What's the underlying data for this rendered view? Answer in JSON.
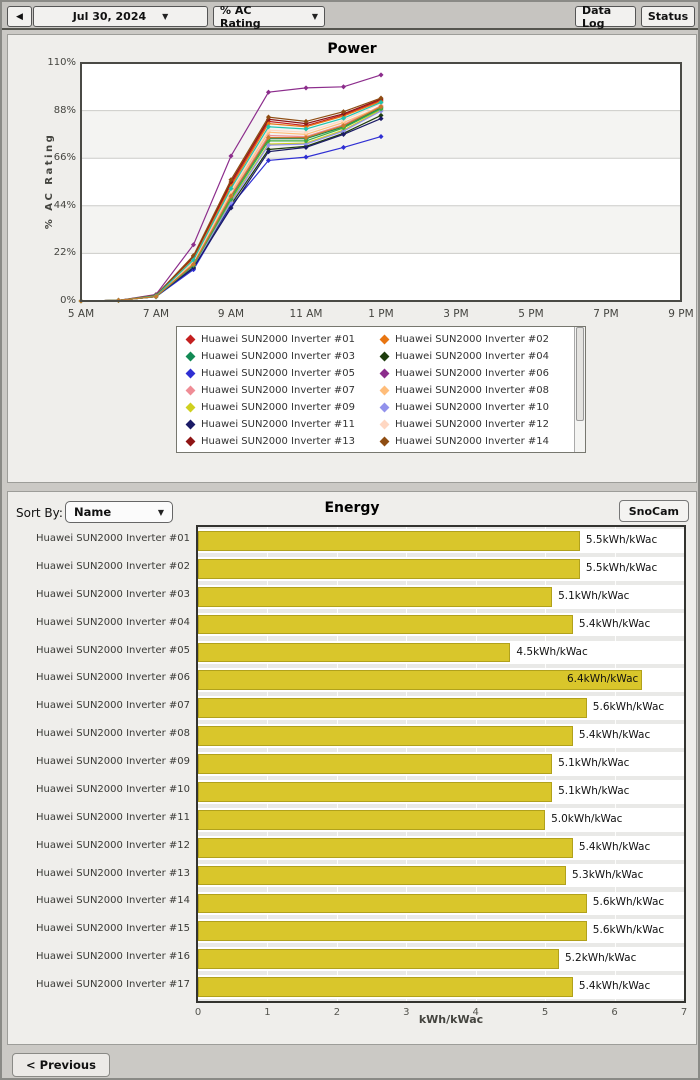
{
  "toolbar": {
    "prev_day_arrow": "◀",
    "date": "Jul 30, 2024",
    "metric": "% AC Rating",
    "dropdown_caret": "▼",
    "data_log": "Data Log",
    "status": "Status"
  },
  "energy_header": {
    "sort_by_label": "Sort By:",
    "sort_by_value": "Name",
    "select_caret": "▼",
    "snocam": "SnoCam"
  },
  "footer": {
    "previous": "< Previous"
  },
  "chart_data": [
    {
      "type": "line",
      "title": "Power",
      "ylabel": "% AC Rating",
      "xlim_hours": [
        5,
        21
      ],
      "ylim": [
        0,
        110
      ],
      "yticks": [
        "0%",
        "22%",
        "44%",
        "66%",
        "88%",
        "110%"
      ],
      "ytick_values": [
        0,
        22,
        44,
        66,
        88,
        110
      ],
      "xticks": [
        "5 AM",
        "7 AM",
        "9 AM",
        "11 AM",
        "1 PM",
        "3 PM",
        "5 PM",
        "7 PM",
        "9 PM"
      ],
      "xtick_hours": [
        5,
        7,
        9,
        11,
        13,
        15,
        17,
        19,
        21
      ],
      "x_hours": [
        5,
        6,
        7,
        8,
        9,
        10,
        11,
        12,
        13
      ],
      "grid": true,
      "legend_position": "bottom",
      "series": [
        {
          "name": "Huawei SUN2000 Inverter #01",
          "color": "#c42020",
          "in_legend": true,
          "values": [
            0,
            0.3,
            2.5,
            20,
            54,
            83,
            81,
            86,
            92.8
          ]
        },
        {
          "name": "Huawei SUN2000 Inverter #02",
          "color": "#e87511",
          "in_legend": true,
          "values": [
            0,
            0.3,
            2.5,
            19.5,
            53,
            82,
            80.5,
            85.5,
            92.3
          ]
        },
        {
          "name": "Huawei SUN2000 Inverter #03",
          "color": "#128a54",
          "in_legend": true,
          "values": [
            0,
            0.3,
            2.1,
            17,
            48,
            75,
            75,
            80.5,
            89.3
          ]
        },
        {
          "name": "Huawei SUN2000 Inverter #04",
          "color": "#1e3d0d",
          "in_legend": true,
          "values": [
            0,
            0.3,
            2,
            15,
            44.5,
            70,
            71.5,
            77.5,
            85.8
          ]
        },
        {
          "name": "Huawei SUN2000 Inverter #05",
          "color": "#2f2fd3",
          "in_legend": true,
          "values": [
            0,
            0.3,
            2,
            14.5,
            44,
            65,
            66.5,
            71,
            76
          ]
        },
        {
          "name": "Huawei SUN2000 Inverter #06",
          "color": "#8c2d8c",
          "in_legend": true,
          "values": [
            0,
            0.3,
            3,
            26,
            67,
            96.5,
            98.5,
            99,
            104.5
          ]
        },
        {
          "name": "Huawei SUN2000 Inverter #07",
          "color": "#ef8d96",
          "in_legend": true,
          "values": [
            0,
            0.3,
            2.2,
            17.5,
            49,
            76.5,
            76,
            81.5,
            90.3
          ]
        },
        {
          "name": "Huawei SUN2000 Inverter #08",
          "color": "#ffbd7a",
          "in_legend": true,
          "values": [
            0,
            0.3,
            2.2,
            18,
            50,
            78,
            77,
            82.5,
            89.8
          ]
        },
        {
          "name": "Huawei SUN2000 Inverter #09",
          "color": "#cfd01f",
          "in_legend": true,
          "values": [
            0,
            0.3,
            2,
            16,
            46,
            72.5,
            73,
            79,
            88.3
          ]
        },
        {
          "name": "Huawei SUN2000 Inverter #10",
          "color": "#9292ec",
          "in_legend": true,
          "values": [
            0,
            0.3,
            2,
            16,
            45.5,
            72,
            72.5,
            78.5,
            87.8
          ]
        },
        {
          "name": "Huawei SUN2000 Inverter #11",
          "color": "#1b1b66",
          "in_legend": true,
          "values": [
            0,
            0.3,
            2,
            15.5,
            43,
            69,
            71,
            77,
            84.3
          ]
        },
        {
          "name": "Huawei SUN2000 Inverter #12",
          "color": "#ffd7c2",
          "in_legend": true,
          "values": [
            0,
            0.3,
            2.3,
            18.5,
            51,
            79,
            78,
            83.5,
            91.3
          ]
        },
        {
          "name": "Huawei SUN2000 Inverter #13",
          "color": "#8f1515",
          "in_legend": true,
          "values": [
            0,
            0.3,
            2.6,
            20.5,
            55,
            84,
            82,
            86.5,
            93.3
          ]
        },
        {
          "name": "Huawei SUN2000 Inverter #14",
          "color": "#8f4d12",
          "in_legend": true,
          "values": [
            0,
            0.3,
            2.7,
            21,
            56,
            85,
            83,
            87.5,
            93.8
          ]
        },
        {
          "name": "Huawei SUN2000 Inverter #15",
          "color": "#1fc4ae",
          "in_legend": false,
          "values": [
            0,
            0.3,
            2.4,
            19,
            52,
            80.5,
            79.5,
            84.5,
            91.8
          ]
        },
        {
          "name": "Huawei SUN2000 Inverter #16",
          "color": "#3fae3f",
          "in_legend": false,
          "values": [
            0,
            0.3,
            2,
            16.5,
            47,
            74,
            74,
            80,
            88.8
          ]
        },
        {
          "name": "Huawei SUN2000 Inverter #17",
          "color": "#c9792f",
          "in_legend": false,
          "values": [
            0,
            0.3,
            2.1,
            17,
            48.5,
            75.5,
            75.5,
            81,
            89.8
          ]
        }
      ]
    },
    {
      "type": "bar",
      "title": "Energy",
      "orientation": "horizontal",
      "categories": [
        "Huawei SUN2000 Inverter #01",
        "Huawei SUN2000 Inverter #02",
        "Huawei SUN2000 Inverter #03",
        "Huawei SUN2000 Inverter #04",
        "Huawei SUN2000 Inverter #05",
        "Huawei SUN2000 Inverter #06",
        "Huawei SUN2000 Inverter #07",
        "Huawei SUN2000 Inverter #08",
        "Huawei SUN2000 Inverter #09",
        "Huawei SUN2000 Inverter #10",
        "Huawei SUN2000 Inverter #11",
        "Huawei SUN2000 Inverter #12",
        "Huawei SUN2000 Inverter #13",
        "Huawei SUN2000 Inverter #14",
        "Huawei SUN2000 Inverter #15",
        "Huawei SUN2000 Inverter #16",
        "Huawei SUN2000 Inverter #17"
      ],
      "values": [
        5.5,
        5.5,
        5.1,
        5.4,
        4.5,
        6.4,
        5.6,
        5.4,
        5.1,
        5.1,
        5.0,
        5.4,
        5.3,
        5.6,
        5.6,
        5.2,
        5.4
      ],
      "labels": [
        "5.5kWh/kWac",
        "5.5kWh/kWac",
        "5.1kWh/kWac",
        "5.4kWh/kWac",
        "4.5kWh/kWac",
        "6.4kWh/kWac",
        "5.6kWh/kWac",
        "5.4kWh/kWac",
        "5.1kWh/kWac",
        "5.1kWh/kWac",
        "5.0kWh/kWac",
        "5.4kWh/kWac",
        "5.3kWh/kWac",
        "5.6kWh/kWac",
        "5.6kWh/kWac",
        "5.2kWh/kWac",
        "5.4kWh/kWac"
      ],
      "xlabel": "kWh/kWac",
      "xticks": [
        "0",
        "1",
        "2",
        "3",
        "4",
        "5",
        "6",
        "7"
      ],
      "xlim": [
        0,
        7
      ],
      "bar_color": "#d9c62b",
      "bar_border_color": "#b1a11c"
    }
  ]
}
